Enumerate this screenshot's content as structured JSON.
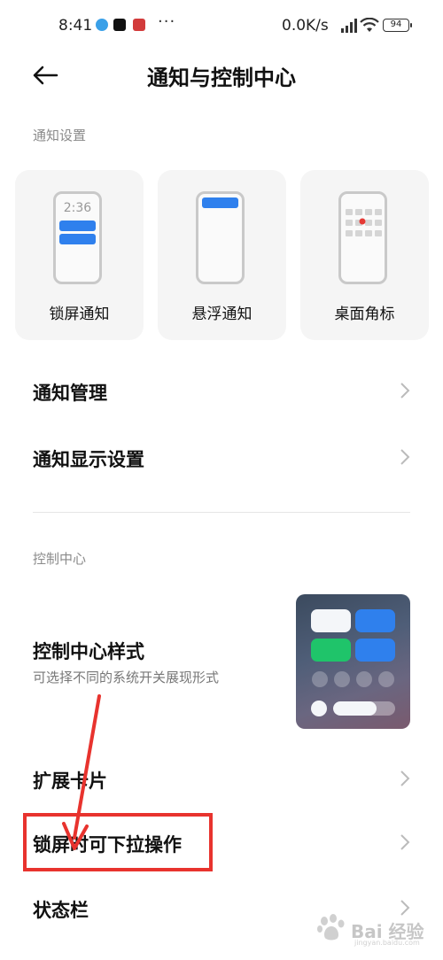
{
  "status_bar": {
    "time": "8:41",
    "dots": "···",
    "speed": "0.0K/s",
    "battery": "94"
  },
  "header": {
    "title": "通知与控制中心"
  },
  "notification_section": {
    "label": "通知设置",
    "cards": [
      {
        "label": "锁屏通知",
        "clock": "2:36"
      },
      {
        "label": "悬浮通知"
      },
      {
        "label": "桌面角标"
      }
    ]
  },
  "notification_rows": [
    {
      "title": "通知管理"
    },
    {
      "title": "通知显示设置"
    }
  ],
  "control_section": {
    "label": "控制中心",
    "style_row": {
      "title": "控制中心样式",
      "subtitle": "可选择不同的系统开关展现形式"
    },
    "rows": [
      {
        "title": "扩展卡片"
      },
      {
        "title": "锁屏时可下拉操作"
      },
      {
        "title": "状态栏"
      }
    ]
  },
  "colors": {
    "accent_blue": "#2f80ed",
    "highlight_red": "#e8332e",
    "green_tile": "#1fc46a"
  },
  "watermark": {
    "text": "Bai 经验",
    "sub": "jingyan.baidu.com"
  }
}
